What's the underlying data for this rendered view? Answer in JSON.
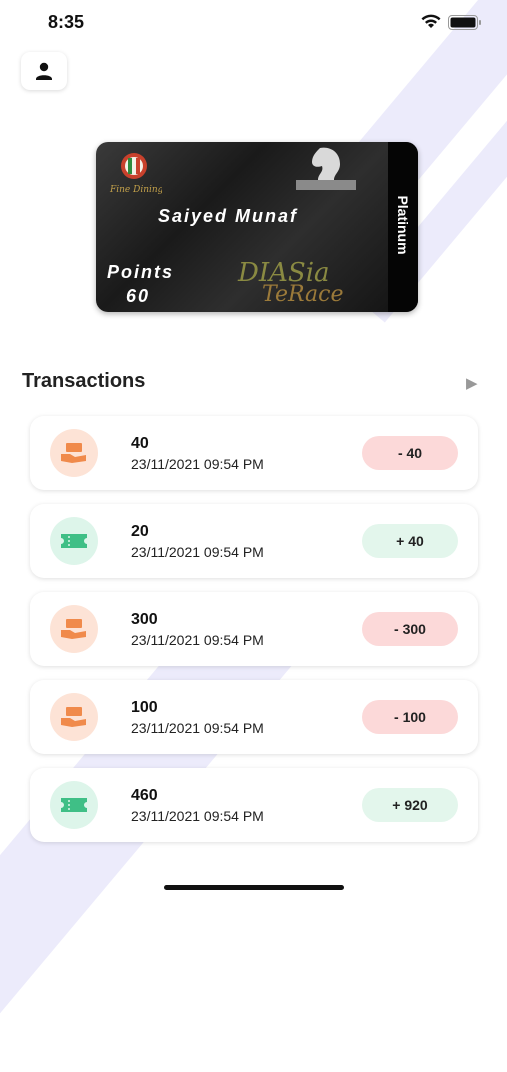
{
  "status_bar": {
    "time": "8:35"
  },
  "card": {
    "holder_name": "Saiyed Munaf",
    "points_label": "Points",
    "points_value": "60",
    "tier": "Platinum",
    "logo_text": "DIASia TeRace",
    "logo_primary": "DIASia",
    "logo_secondary": "TeRace"
  },
  "transactions": {
    "title": "Transactions",
    "items": [
      {
        "amount": "40",
        "date": "23/11/2021 09:54 PM",
        "badge": "- 40",
        "kind": "debit"
      },
      {
        "amount": "20",
        "date": "23/11/2021 09:54 PM",
        "badge": "+ 40",
        "kind": "credit"
      },
      {
        "amount": "300",
        "date": "23/11/2021 09:54 PM",
        "badge": "- 300",
        "kind": "debit"
      },
      {
        "amount": "100",
        "date": "23/11/2021 09:54 PM",
        "badge": "- 100",
        "kind": "debit"
      },
      {
        "amount": "460",
        "date": "23/11/2021 09:54 PM",
        "badge": "+ 920",
        "kind": "credit"
      }
    ]
  },
  "colors": {
    "debit_icon": "#f08a4b",
    "credit_icon": "#3fbf86",
    "debit_badge_bg": "#fcd9d9",
    "credit_badge_bg": "#e3f6ec",
    "accent_stripe": "#ecebfb"
  },
  "icons": {
    "profile": "person-icon",
    "debit": "hand-money-icon",
    "credit": "ticket-icon",
    "more": "triangle-right-icon"
  }
}
